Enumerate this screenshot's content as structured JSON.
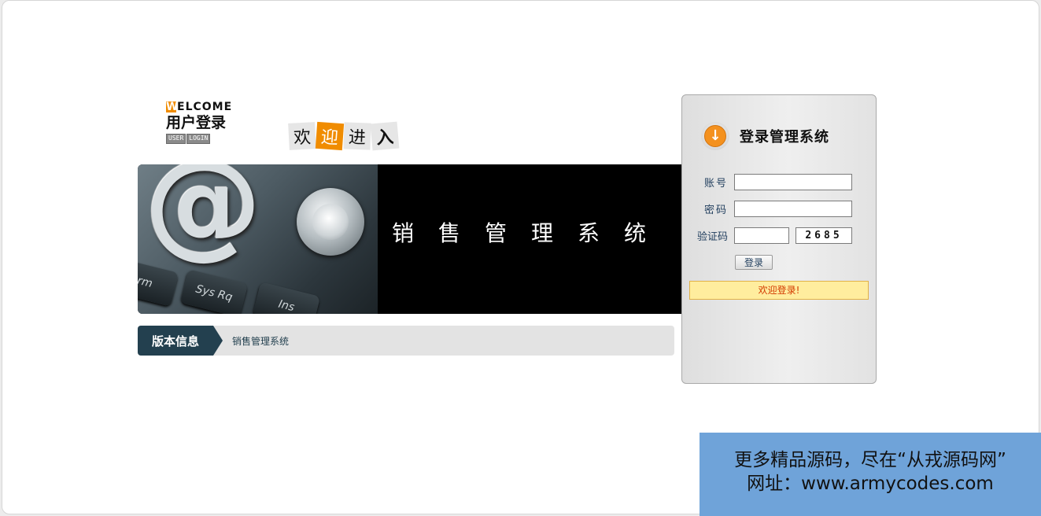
{
  "header": {
    "welcome_w": "W",
    "welcome_rest": "ELCOME",
    "welcome_cn": "用户登录",
    "welcome_sub_words": [
      "USER",
      "LOGIN"
    ],
    "hello_tiles": [
      "欢",
      "迎",
      "进",
      "入"
    ]
  },
  "banner": {
    "title": "销售管理系统",
    "keys": [
      "rm",
      "Sys Rq",
      "Ins"
    ]
  },
  "version": {
    "tag": "版本信息",
    "text": "销售管理系统"
  },
  "login": {
    "title": "登录管理系统",
    "account_label": "账号",
    "password_label": "密码",
    "captcha_label": "验证码",
    "account_value": "",
    "password_value": "",
    "captcha_value": "",
    "captcha_code": "2685",
    "submit_label": "登录",
    "notice": "欢迎登录!"
  },
  "watermark": {
    "line1": "更多精品源码，尽在“从戎源码网”",
    "line2": "网址：www.armycodes.com"
  },
  "colors": {
    "accent": "#f08c00",
    "dark_blue": "#23404f",
    "notice_bg": "#ffed9e",
    "watermark_bg": "#6fa3d9"
  }
}
